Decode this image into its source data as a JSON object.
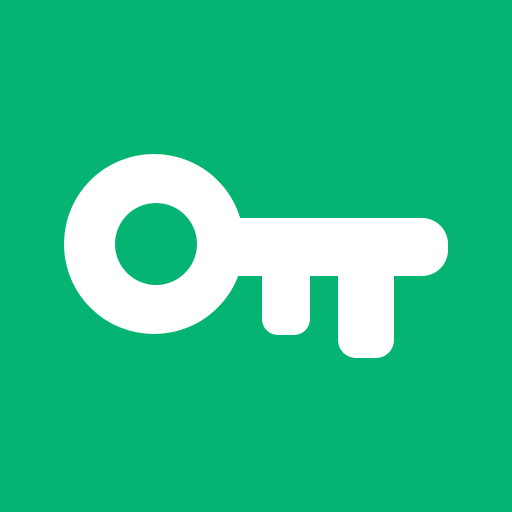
{
  "icon": {
    "name": "key-icon",
    "background_color": "#05B372",
    "foreground_color": "#FFFFFF"
  }
}
